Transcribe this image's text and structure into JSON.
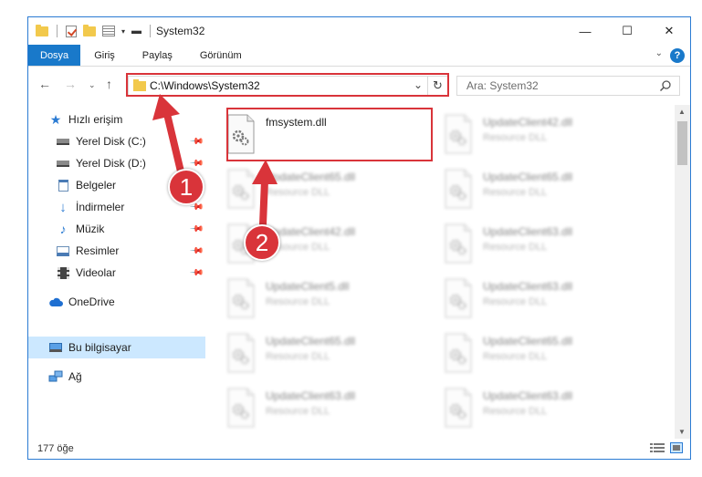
{
  "window": {
    "title": "System32",
    "controls": {
      "minimize": "—",
      "maximize": "☐",
      "close": "✕"
    }
  },
  "ribbon": {
    "tabs": [
      {
        "label": "Dosya",
        "active": true
      },
      {
        "label": "Giriş"
      },
      {
        "label": "Paylaş"
      },
      {
        "label": "Görünüm"
      }
    ],
    "help": "?"
  },
  "navigation": {
    "address_path": "C:\\Windows\\System32",
    "search_placeholder": "Ara: System32"
  },
  "sidebar": {
    "items": [
      {
        "label": "Hızlı erişim",
        "icon": "star-icon"
      },
      {
        "label": "Yerel Disk (C:)",
        "icon": "drive-icon",
        "pinned": true
      },
      {
        "label": "Yerel Disk (D:)",
        "icon": "drive-icon",
        "pinned": true
      },
      {
        "label": "Belgeler",
        "icon": "documents-icon",
        "pinned": true
      },
      {
        "label": "İndirmeler",
        "icon": "download-icon",
        "pinned": true
      },
      {
        "label": "Müzik",
        "icon": "music-icon",
        "pinned": true
      },
      {
        "label": "Resimler",
        "icon": "pictures-icon",
        "pinned": true
      },
      {
        "label": "Videolar",
        "icon": "videos-icon",
        "pinned": true
      },
      {
        "label": "OneDrive",
        "icon": "cloud-icon"
      },
      {
        "label": "Bu bilgisayar",
        "icon": "computer-icon",
        "selected": true
      },
      {
        "label": "Ağ",
        "icon": "network-icon"
      }
    ]
  },
  "files": [
    {
      "name": "fmsystem.dll",
      "type": "",
      "highlighted": true
    },
    {
      "name": "UpdateClient42.dll",
      "type": "Resource DLL"
    },
    {
      "name": "UpdateClient65.dll",
      "type": "Resource DLL"
    },
    {
      "name": "UpdateClient65.dll",
      "type": "Resource DLL"
    },
    {
      "name": "UpdateClient42.dll",
      "type": "Resource DLL"
    },
    {
      "name": "UpdateClient63.dll",
      "type": "Resource DLL"
    },
    {
      "name": "UpdateClient5.dll",
      "type": "Resource DLL"
    },
    {
      "name": "UpdateClient63.dll",
      "type": "Resource DLL"
    },
    {
      "name": "UpdateClient65.dll",
      "type": "Resource DLL"
    },
    {
      "name": "UpdateClient65.dll",
      "type": "Resource DLL"
    },
    {
      "name": "UpdateClient63.dll",
      "type": "Resource DLL"
    },
    {
      "name": "UpdateClient63.dll",
      "type": "Resource DLL"
    }
  ],
  "status": {
    "item_count": "177 öğe"
  },
  "annotations": {
    "step1": "1",
    "step2": "2",
    "color": "#d9343a"
  }
}
